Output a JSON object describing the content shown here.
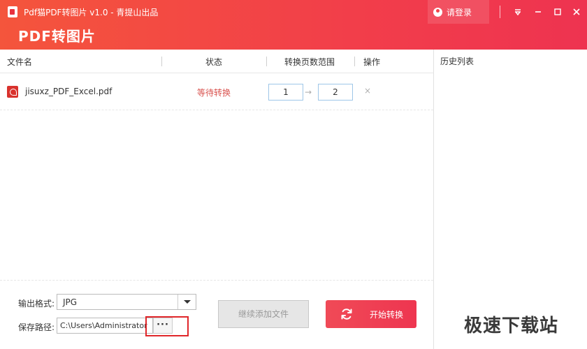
{
  "window": {
    "title": "Pdf猫PDF转图片 v1.0 - 青提山出品",
    "big_title": "PDF转图片",
    "login_label": "请登录"
  },
  "icons": {
    "app": "app-logo-icon",
    "user": "user-icon",
    "menu": "menu-icon",
    "minimize": "minimize-icon",
    "maximize": "maximize-icon",
    "close": "close-icon",
    "pdf": "pdf-file-icon",
    "refresh": "refresh-icon"
  },
  "columns": {
    "filename": "文件名",
    "status": "状态",
    "page_range": "转换页数范围",
    "action": "操作"
  },
  "files": [
    {
      "name": "jisuxz_PDF_Excel.pdf",
      "status": "等待转换",
      "page_from": "1",
      "arrow": "→",
      "page_to": "2",
      "delete": "×"
    }
  ],
  "history": {
    "title": "历史列表"
  },
  "output": {
    "format_label": "输出格式:",
    "format_value": "JPG",
    "path_label": "保存路径:",
    "path_value": "C:\\Users\\Administrator",
    "browse_label": "···"
  },
  "buttons": {
    "add_more": "继续添加文件",
    "start": "开始转换"
  },
  "watermark": "极速下载站",
  "colors": {
    "brand_gradient_start": "#f4553c",
    "brand_gradient_end": "#ee3350",
    "status_waiting": "#d9534f",
    "highlight_box": "#e0262a"
  }
}
